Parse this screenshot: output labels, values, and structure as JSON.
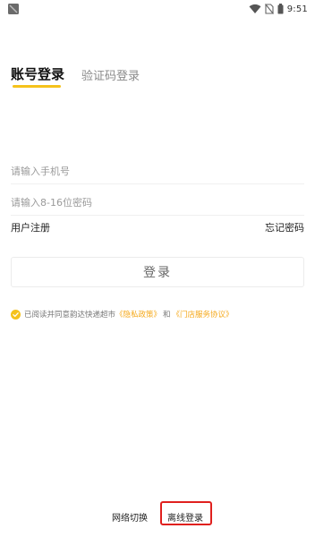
{
  "status_bar": {
    "time": "9:51",
    "icons": [
      "app-icon",
      "wifi-icon",
      "no-sim-icon",
      "battery-icon"
    ]
  },
  "tabs": [
    {
      "label": "账号登录",
      "active": true
    },
    {
      "label": "验证码登录",
      "active": false
    }
  ],
  "form": {
    "phone_placeholder": "请输入手机号",
    "phone_value": "",
    "password_placeholder": "请输入8-16位密码",
    "password_value": ""
  },
  "links": {
    "register": "用户注册",
    "forgot_password": "忘记密码"
  },
  "login_button": "登录",
  "agreement": {
    "checked": true,
    "prefix": "已阅读并同意韵达快递超市",
    "privacy_link": "《隐私政策》",
    "joiner": "和",
    "service_link": "《门店服务协议》"
  },
  "bottom": {
    "network_switch": "网络切换",
    "offline_login": "离线登录"
  },
  "colors": {
    "accent": "#f5c21b",
    "link": "#f5a91b",
    "highlight": "#e0201e"
  }
}
